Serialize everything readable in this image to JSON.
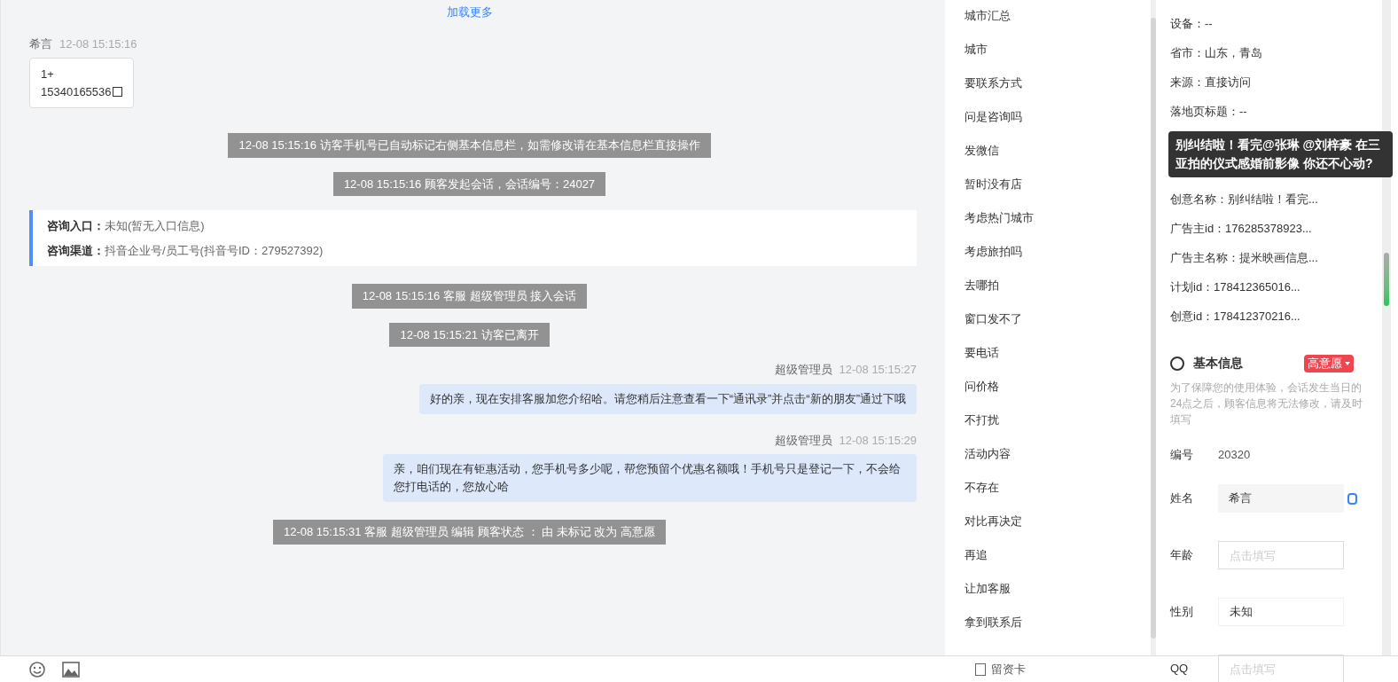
{
  "chat": {
    "load_more": "加载更多",
    "messages": [
      {
        "kind": "visitor",
        "sender": "希言",
        "time": "12-08 15:15:16",
        "lines": [
          "1+",
          "15340165536"
        ]
      },
      {
        "kind": "system",
        "text": "12-08 15:15:16 访客手机号已自动标记右侧基本信息栏，如需修改请在基本信息栏直接操作"
      },
      {
        "kind": "system",
        "text": "12-08 15:15:16 顾客发起会话，会话编号：24027"
      },
      {
        "kind": "entry",
        "rows": [
          {
            "label": "咨询入口：",
            "value": "未知(暂无入口信息)"
          },
          {
            "label": "咨询渠道：",
            "value": "抖音企业号/员工号(抖音号ID：279527392)"
          }
        ]
      },
      {
        "kind": "system",
        "text": "12-08 15:15:16 客服 超级管理员 接入会话"
      },
      {
        "kind": "system",
        "text": "12-08 15:15:21 访客已离开"
      },
      {
        "kind": "agent",
        "sender": "超级管理员",
        "time": "12-08 15:15:27",
        "text": "好的亲，现在安排客服加您介绍哈。请您稍后注意查看一下“通讯录”并点击“新的朋友”通过下哦"
      },
      {
        "kind": "agent",
        "sender": "超级管理员",
        "time": "12-08 15:15:29",
        "text": "亲，咱们现在有钜惠活动，您手机号多少呢，帮您预留个优惠名额哦！手机号只是登记一下，不会给您打电话的，您放心哈"
      },
      {
        "kind": "system",
        "text": "12-08 15:15:31 客服 超级管理员 编辑 顾客状态 ： 由 未标记 改为 高意愿"
      }
    ]
  },
  "quick_replies": [
    "城市汇总",
    "城市",
    "要联系方式",
    "问是咨询吗",
    "发微信",
    "暂时没有店",
    "考虑热门城市",
    "考虑旅拍吗",
    "去哪拍",
    "窗口发不了",
    "要电话",
    "问价格",
    "不打扰",
    "活动内容",
    "不存在",
    "对比再决定",
    "再追",
    "让加客服",
    "拿到联系后"
  ],
  "visit_info": {
    "rows_before_tooltip": [
      "设备：--",
      "省市：山东，青岛",
      "来源：直接访问",
      "落地页标题：--"
    ],
    "tooltip": "别纠结啦！看完@张琳 @刘梓豪 在三亚拍的仪式感婚前影像 你还不心动?",
    "rows_after_tooltip": [
      "创意名称：别纠结啦！看完...",
      "广告主id：176285378923...",
      "广告主名称：提米映画信息...",
      "计划id：178412365016...",
      "创意id：178412370216..."
    ]
  },
  "basic_info": {
    "title": "基本信息",
    "status": "高意愿",
    "notice": "为了保障您的使用体验，会话发生当日的24点之后，顾客信息将无法修改，请及时填写",
    "fields": [
      {
        "kind": "static",
        "label": "编号",
        "value": "20320"
      },
      {
        "kind": "filled",
        "label": "姓名",
        "value": "希言"
      },
      {
        "kind": "input",
        "label": "年龄",
        "placeholder": "点击填写"
      },
      {
        "kind": "select",
        "label": "性别",
        "value": "未知"
      },
      {
        "kind": "input",
        "label": "QQ",
        "placeholder": "点击填写"
      }
    ]
  },
  "toolbar": {
    "card_button": "留资卡"
  }
}
